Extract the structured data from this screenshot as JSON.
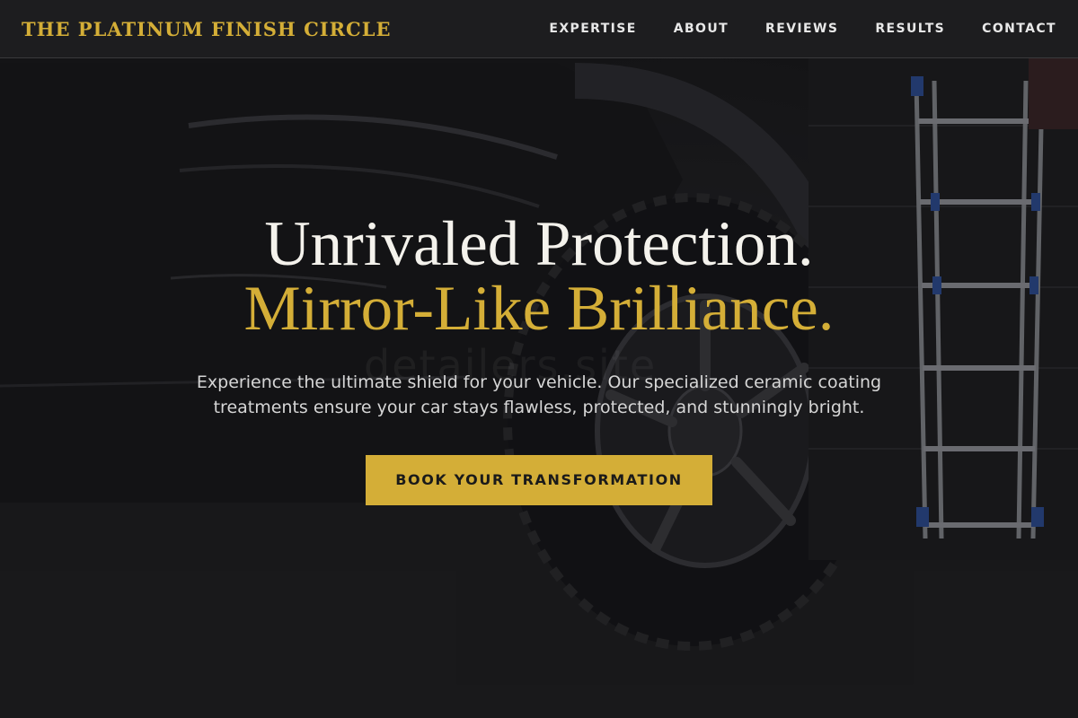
{
  "brand": {
    "name": "THE PLATINUM FINISH CIRCLE"
  },
  "nav": {
    "items": [
      {
        "label": "EXPERTISE"
      },
      {
        "label": "ABOUT"
      },
      {
        "label": "REVIEWS"
      },
      {
        "label": "RESULTS"
      },
      {
        "label": "CONTACT"
      }
    ]
  },
  "hero": {
    "headline_line1": "Unrivaled Protection.",
    "headline_line2": "Mirror-Like Brilliance.",
    "subtext": "Experience the ultimate shield for your vehicle. Our specialized ceramic coating treatments ensure your car stays flawless, protected, and stunningly bright.",
    "cta_label": "BOOK YOUR TRANSFORMATION",
    "watermark": "detailers.site",
    "background_image": "dark-truck-wheel-garage-photo"
  },
  "colors": {
    "accent": "#d4ae37",
    "headline_white": "#f4f2ec",
    "navbar_bg": "#1e1e20",
    "body_text": "#d6d6d6"
  }
}
